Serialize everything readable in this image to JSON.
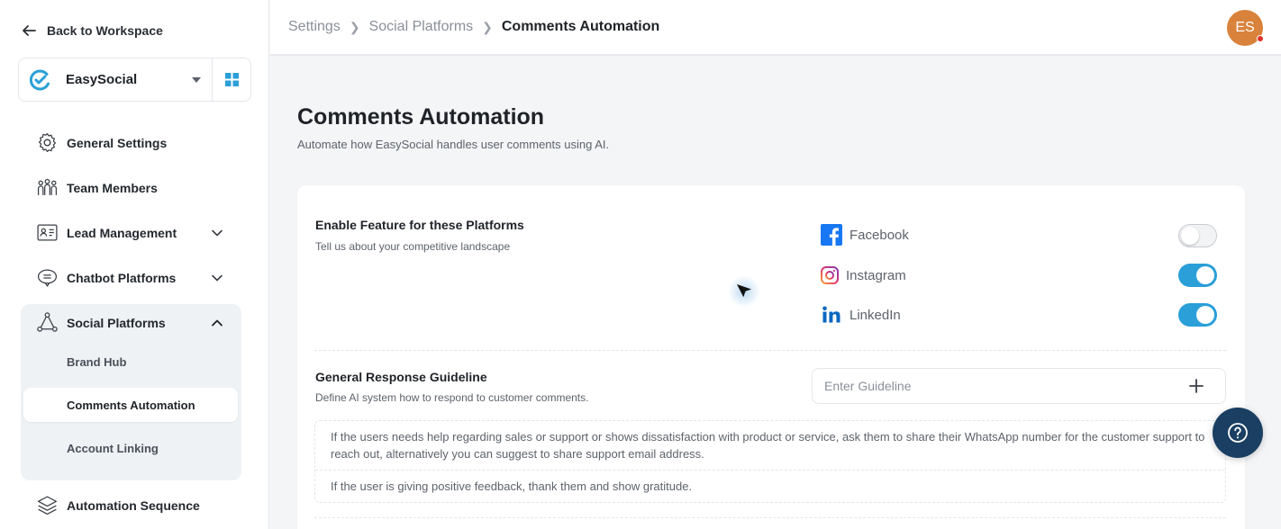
{
  "sidebar": {
    "back_label": "Back to Workspace",
    "workspace": {
      "name": "EasySocial"
    },
    "items": [
      {
        "label": "General Settings"
      },
      {
        "label": "Team Members"
      },
      {
        "label": "Lead Management"
      },
      {
        "label": "Chatbot Platforms"
      },
      {
        "label": "Social Platforms"
      },
      {
        "label": "Automation Sequence"
      }
    ],
    "social_sub": [
      {
        "label": "Brand Hub"
      },
      {
        "label": "Comments Automation"
      },
      {
        "label": "Account Linking"
      }
    ]
  },
  "header": {
    "breadcrumb": [
      "Settings",
      "Social Platforms",
      "Comments Automation"
    ],
    "avatar_initials": "ES"
  },
  "page": {
    "title": "Comments Automation",
    "subtitle": "Automate how EasySocial handles user comments using AI."
  },
  "platforms_section": {
    "title": "Enable Feature for these Platforms",
    "subtitle": "Tell us about your competitive landscape",
    "platforms": [
      {
        "name": "Facebook",
        "enabled": false
      },
      {
        "name": "Instagram",
        "enabled": true
      },
      {
        "name": "LinkedIn",
        "enabled": true
      }
    ]
  },
  "guideline_section": {
    "title": "General Response Guideline",
    "subtitle": "Define AI system how to respond to customer comments.",
    "input_placeholder": "Enter Guideline",
    "guidelines": [
      "If the users needs help regarding sales or support or shows dissatisfaction with product or service, ask them to share their WhatsApp number for the customer support to reach out, alternatively you can suggest to share support email address.",
      "If the user is giving positive feedback, thank them and show gratitude."
    ]
  },
  "colors": {
    "toggle_on": "#2a9fd8",
    "avatar": "#d9823b",
    "help_button": "#1a3f63",
    "facebook": "#1877f2",
    "linkedin": "#0a66c2"
  }
}
